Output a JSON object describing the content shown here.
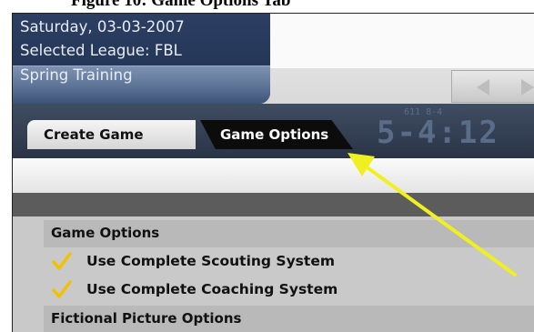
{
  "caption": "Figure 10: Game Options Tab",
  "header": {
    "date": "Saturday, 03-03-2007",
    "league": "Selected League: FBL",
    "phase": "Spring Training"
  },
  "scoreboard": {
    "big": "5-4:12",
    "small": "611  8-4"
  },
  "tabs": [
    {
      "label": "Create Game",
      "active": false
    },
    {
      "label": "Game Options",
      "active": true
    }
  ],
  "options": {
    "section_game": "Game Options",
    "scouting": {
      "label": "Use Complete Scouting System",
      "checked": true
    },
    "coaching": {
      "label": "Use Complete Coaching System",
      "checked": true
    },
    "section_picture": "Fictional Picture Options"
  },
  "colors": {
    "accent_arrow": "#f0f020",
    "checkmark": "#f2c200",
    "header_bg": "#2c3f63"
  },
  "icons": {
    "prev": "left-triangle",
    "next": "right-triangle",
    "check": "checkmark"
  }
}
